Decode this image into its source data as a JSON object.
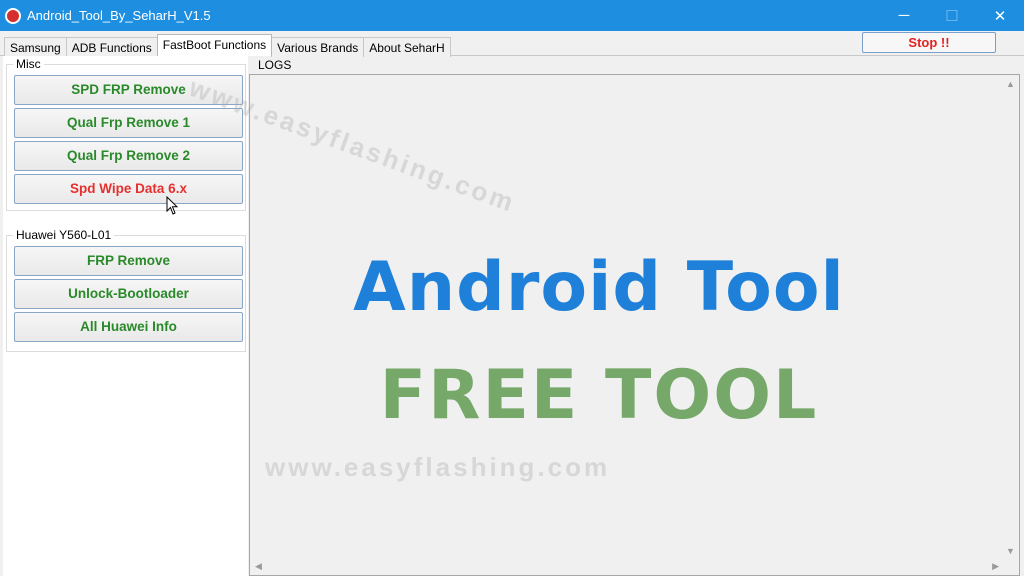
{
  "window": {
    "title": "Android_Tool_By_SeharH_V1.5",
    "controls": {
      "minimize": "─",
      "maximize": "☐",
      "close": "✕"
    }
  },
  "tabs": [
    {
      "label": "Samsung",
      "active": false
    },
    {
      "label": "ADB Functions",
      "active": false
    },
    {
      "label": "FastBoot Functions",
      "active": true
    },
    {
      "label": "Various Brands",
      "active": false
    },
    {
      "label": "About SeharH",
      "active": false
    }
  ],
  "stop_button": "Stop !!",
  "misc": {
    "label": "Misc",
    "buttons": [
      {
        "label": "SPD FRP Remove",
        "color": "#2a8a2a"
      },
      {
        "label": "Qual Frp Remove 1",
        "color": "#2a8a2a"
      },
      {
        "label": "Qual Frp Remove 2",
        "color": "#2a8a2a"
      },
      {
        "label": "Spd Wipe Data 6.x",
        "color": "#e53030"
      }
    ]
  },
  "huawei": {
    "label": "Huawei Y560-L01",
    "buttons": [
      {
        "label": "FRP Remove"
      },
      {
        "label": "Unlock-Bootloader"
      },
      {
        "label": "All Huawei Info"
      }
    ]
  },
  "logs": {
    "label": "LOGS",
    "headline1": "Android Tool",
    "headline2": "FREE TOOL"
  },
  "watermarks": [
    "www.easyflashing.com",
    "www.easyflashing.com"
  ],
  "colors": {
    "titlebar": "#1e8fe0",
    "headline_blue": "#1e80d8",
    "headline_green": "#76a86a",
    "stop": "#e52222"
  }
}
